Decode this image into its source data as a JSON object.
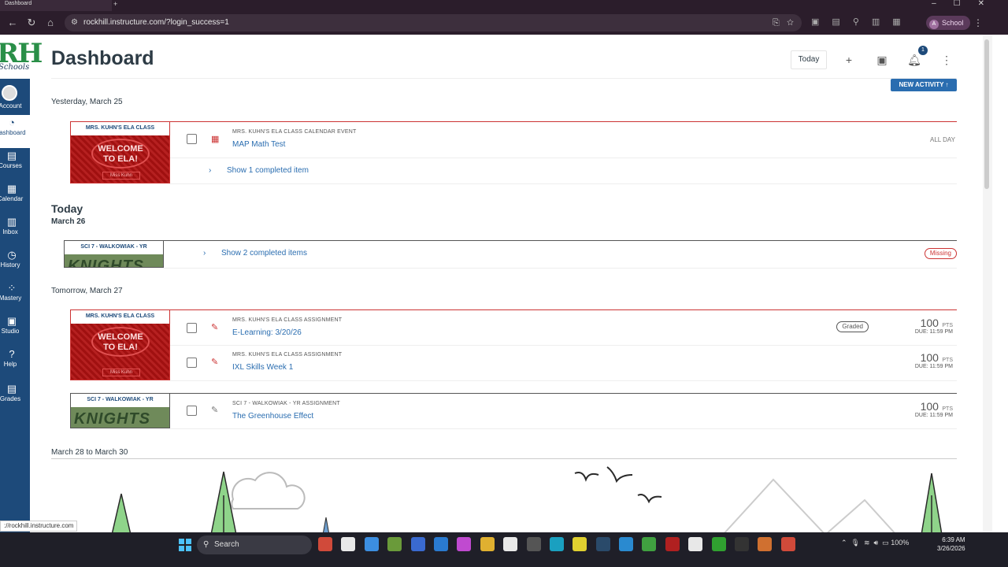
{
  "browser": {
    "tab_title": "Dashboard",
    "url": "rockhill.instructure.com/?login_success=1",
    "profile_label": "School",
    "profile_initial": "A"
  },
  "global_nav": {
    "logo_text": "RH",
    "logo_sub": "Schools",
    "items": [
      {
        "label": "Account",
        "icon": "account-icon"
      },
      {
        "label": "Dashboard",
        "icon": "dashboard-icon"
      },
      {
        "label": "Courses",
        "icon": "courses-icon"
      },
      {
        "label": "Calendar",
        "icon": "calendar-icon"
      },
      {
        "label": "Inbox",
        "icon": "inbox-icon"
      },
      {
        "label": "History",
        "icon": "history-icon"
      },
      {
        "label": "Mastery",
        "icon": "mastery-icon"
      },
      {
        "label": "Studio",
        "icon": "studio-icon"
      },
      {
        "label": "Help",
        "icon": "help-icon"
      },
      {
        "label": "Grades",
        "icon": "grades-icon"
      }
    ]
  },
  "header": {
    "title": "Dashboard",
    "today_label": "Today",
    "notification_count": "1",
    "new_activity_label": "NEW ACTIVITY ↑"
  },
  "planner": {
    "yesterday": {
      "label": "Yesterday, March 25",
      "card_title": "MRS. KUHN'S ELA CLASS",
      "card_welcome": "WELCOME TO ELA!",
      "card_sig": "Miss Kuhn",
      "item_context": "MRS. KUHN'S ELA CLASS CALENDAR EVENT",
      "item_title": "MAP Math Test",
      "item_time": "ALL DAY",
      "show_completed": "Show 1 completed item"
    },
    "today": {
      "heading": "Today",
      "date": "March 26",
      "card_title": "SCI 7 - WALKOWIAK - YR",
      "card_art": "KNIGHTS",
      "show_completed": "Show 2 completed items",
      "status": "Missing"
    },
    "tomorrow": {
      "label": "Tomorrow, March 27",
      "ela_card_title": "MRS. KUHN'S ELA CLASS",
      "ela_welcome": "WELCOME TO ELA!",
      "ela_sig": "Miss Kuhn",
      "items": [
        {
          "context": "MRS. KUHN'S ELA CLASS ASSIGNMENT",
          "title": "E-Learning: 3/20/26",
          "status": "Graded",
          "points": "100",
          "pts_unit": "PTS",
          "due": "DUE: 11:59 PM"
        },
        {
          "context": "MRS. KUHN'S ELA CLASS ASSIGNMENT",
          "title": "IXL Skills Week 1",
          "points": "100",
          "pts_unit": "PTS",
          "due": "DUE: 11:59 PM"
        }
      ],
      "sci_card_title": "SCI 7 - WALKOWIAK - YR",
      "sci_art": "KNIGHTS",
      "sci_item": {
        "context": "SCI 7 - WALKOWIAK - YR ASSIGNMENT",
        "title": "The Greenhouse Effect",
        "points": "100",
        "pts_unit": "PTS",
        "due": "DUE: 11:59 PM"
      }
    },
    "range": {
      "label": "March 28 to March 30"
    }
  },
  "status_bar_url": "://rockhill.instructure.com",
  "taskbar": {
    "search_placeholder": "Search",
    "battery": "100%",
    "time": "6:39 AM",
    "date": "3/26/2026"
  }
}
